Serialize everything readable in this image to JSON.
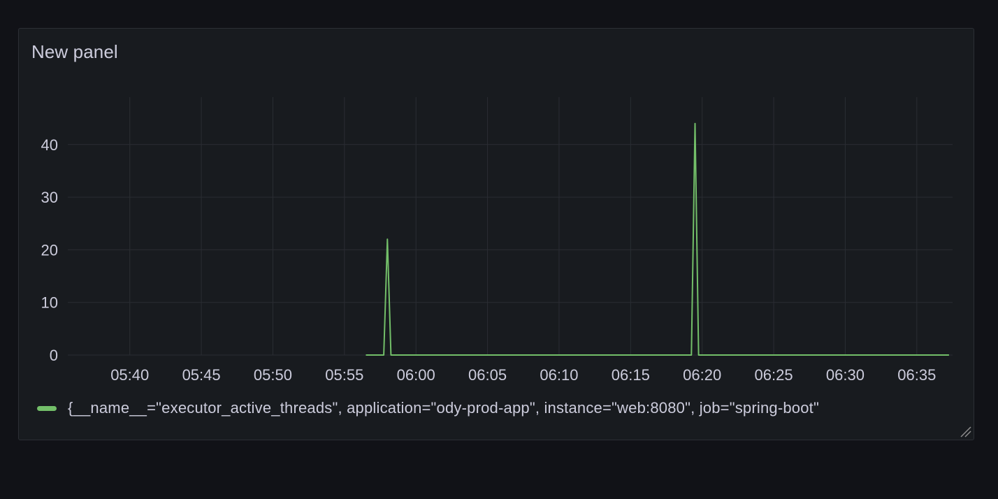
{
  "panel": {
    "title": "New panel"
  },
  "colors": {
    "series": "#73bf69",
    "grid": "#2a2d33",
    "text": "#ccccdc"
  },
  "icons": {
    "resize": "resize-handle-icon"
  },
  "chart_data": {
    "type": "line",
    "title": "New panel",
    "xlabel": "",
    "ylabel": "",
    "x_ticks": [
      "05:40",
      "05:45",
      "05:50",
      "05:55",
      "06:00",
      "06:05",
      "06:10",
      "06:15",
      "06:20",
      "06:25",
      "06:30",
      "06:35"
    ],
    "y_ticks": [
      0,
      10,
      20,
      30,
      40
    ],
    "xlim": [
      "05:35:40",
      "06:37:30"
    ],
    "ylim": [
      0,
      49
    ],
    "grid": true,
    "legend_position": "bottom",
    "series": [
      {
        "name": "{__name__=\"executor_active_threads\", application=\"ody-prod-app\", instance=\"web:8080\", job=\"spring-boot\"",
        "color": "#73bf69",
        "points": [
          [
            "05:56:30",
            0
          ],
          [
            "05:57:45",
            0
          ],
          [
            "05:58:00",
            22
          ],
          [
            "05:58:15",
            0
          ],
          [
            "06:19:15",
            0
          ],
          [
            "06:19:30",
            44
          ],
          [
            "06:19:45",
            0
          ],
          [
            "06:37:15",
            0
          ]
        ]
      }
    ]
  }
}
